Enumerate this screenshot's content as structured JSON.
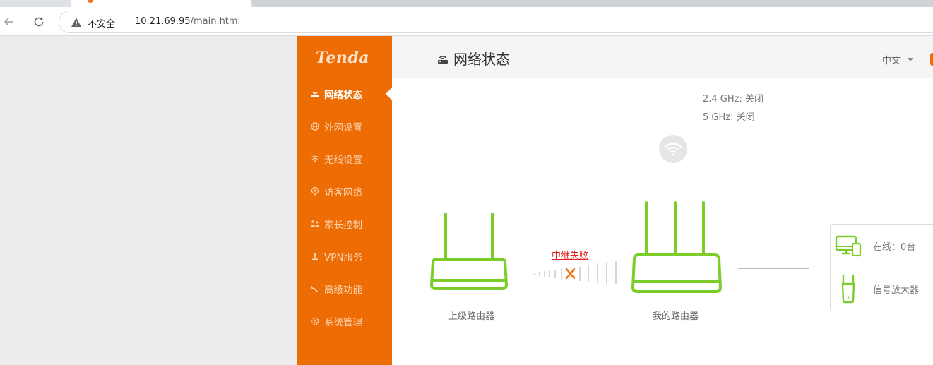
{
  "browser": {
    "security_label": "不安全",
    "url_host": "10.21.69.95",
    "url_path": "/main.html"
  },
  "sidebar": {
    "logo": "Tenda",
    "items": [
      {
        "label": "网络状态",
        "icon": "router-icon",
        "active": true
      },
      {
        "label": "外网设置",
        "icon": "globe-icon",
        "active": false
      },
      {
        "label": "无线设置",
        "icon": "wifi-icon",
        "active": false
      },
      {
        "label": "访客网络",
        "icon": "guest-icon",
        "active": false
      },
      {
        "label": "家长控制",
        "icon": "family-icon",
        "active": false
      },
      {
        "label": "VPN服务",
        "icon": "vpn-icon",
        "active": false
      },
      {
        "label": "高级功能",
        "icon": "wrench-icon",
        "active": false
      },
      {
        "label": "系统管理",
        "icon": "gear-icon",
        "active": false
      }
    ]
  },
  "header": {
    "title": "网络状态",
    "language": "中文"
  },
  "status": {
    "wifi_24": "2.4 GHz: 关闭",
    "wifi_5": "5 GHz: 关闭",
    "relay_status": "中继失败",
    "upper_router_label": "上级路由器",
    "my_router_label": "我的路由器",
    "online_clients": "在线：0台",
    "extender_label": "信号放大器"
  },
  "colors": {
    "accent": "#ee6c04",
    "device_green": "#7ccd2c",
    "error_red": "#e02020"
  }
}
